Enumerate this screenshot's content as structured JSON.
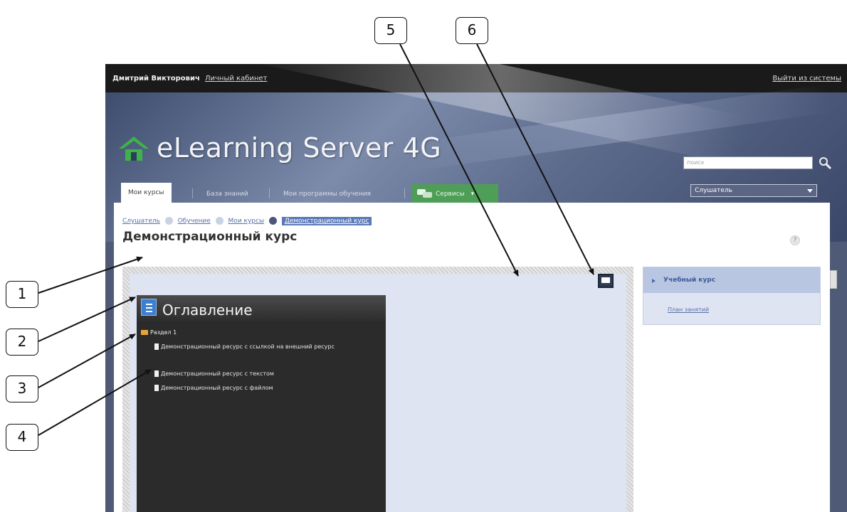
{
  "topbar": {
    "user_name": "Дмитрий Викторович",
    "cabinet_link": "Личный кабинет",
    "logout_link": "Выйти из системы"
  },
  "header": {
    "logo_text": "eLearning Server 4G",
    "search_placeholder": "поиск"
  },
  "tabs": [
    {
      "label": "Мои курсы"
    },
    {
      "label": "База знаний"
    },
    {
      "label": "Мои программы обучения"
    },
    {
      "label": "Сервисы"
    }
  ],
  "role_select": {
    "value": "Слушатель"
  },
  "breadcrumb": [
    "Слушатель",
    "Обучение",
    "Мои курсы",
    "Демонстрационный курс"
  ],
  "page_title": "Демонстрационный курс",
  "help_label": "?",
  "toc": {
    "title": "Оглавление",
    "section": "Раздел 1",
    "items": [
      "Демонстрационный ресурс с ссылкой на внешний ресурс",
      "Демонстрационный ресурс с текстом",
      "Демонстрационный ресурс с файлом"
    ]
  },
  "side_panel": {
    "title": "Учебный курс",
    "link": "План занятий"
  },
  "callouts": [
    "1",
    "2",
    "3",
    "4",
    "5",
    "6"
  ],
  "colors": {
    "header_bg": "#5c6a8c",
    "service_tab": "#4e9e57",
    "viewer_bg": "#dfe4f3",
    "toc_bg": "#2b2b2b",
    "logo_green": "#3fb24a"
  }
}
